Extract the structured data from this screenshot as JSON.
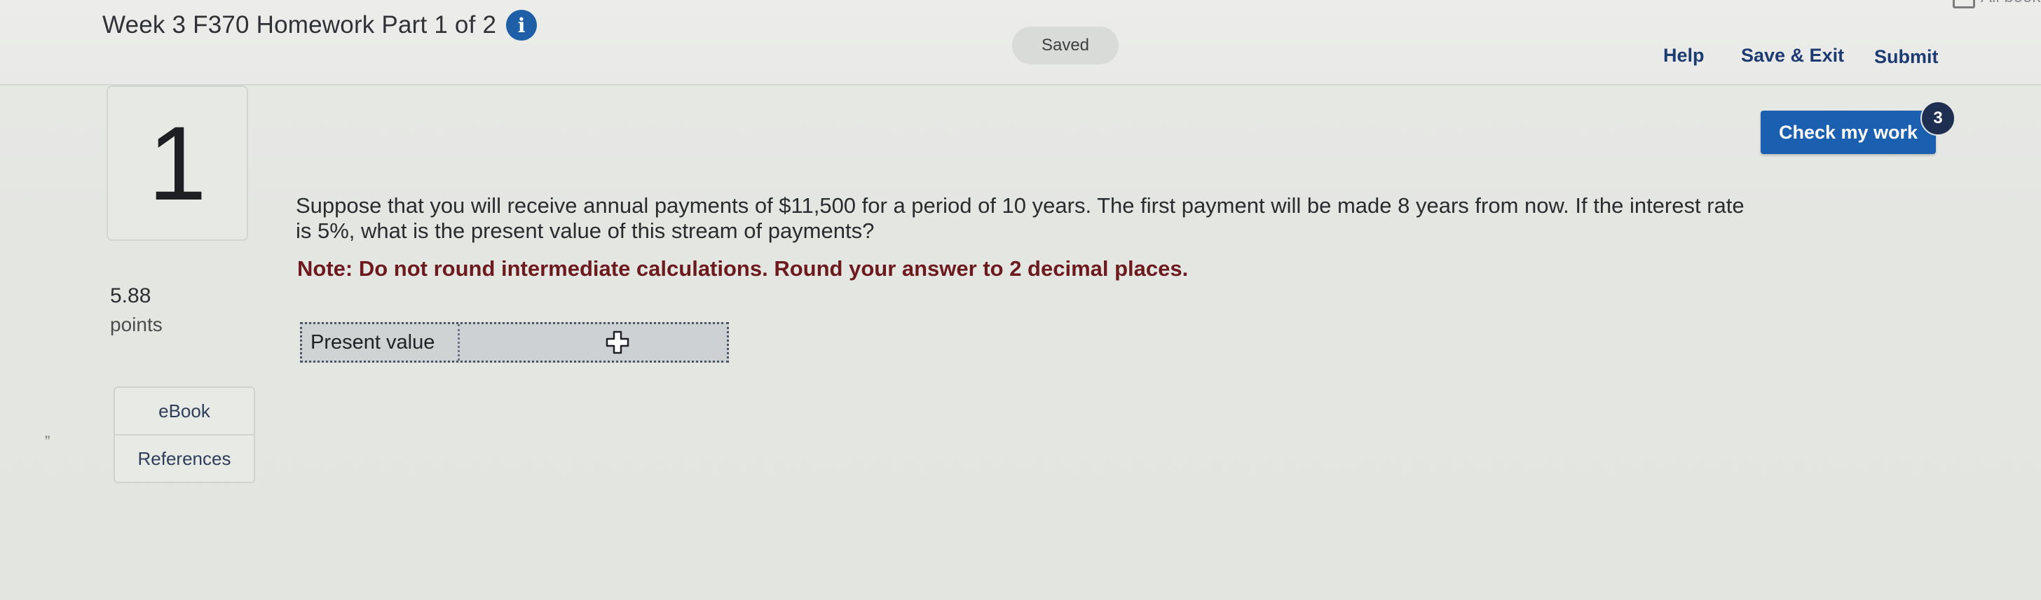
{
  "header": {
    "title": "Week 3 F370 Homework Part 1 of 2",
    "info_icon": "i",
    "saved_status": "Saved",
    "links": {
      "help": "Help",
      "save_exit": "Save & Exit",
      "submit": "Submit"
    },
    "corner_text": "All books"
  },
  "check_work": {
    "label": "Check my work",
    "badge_count": "3"
  },
  "question": {
    "number": "1",
    "points_value": "5.88",
    "points_label": "points",
    "text": "Suppose that you will receive annual payments of $11,500 for a period of 10 years. The first payment will be made 8 years from now. If the interest rate is 5%, what is the present value of this stream of payments?",
    "note": "Note: Do not round intermediate calculations. Round your answer to 2 decimal places."
  },
  "side_buttons": {
    "ebook": "eBook",
    "references": "References"
  },
  "answer_table": {
    "label": "Present value",
    "value": ""
  },
  "stray_mark": "”",
  "colors": {
    "accent_blue": "#1b5fb0",
    "link_navy": "#1d3b73",
    "note_red": "#6d1a1f",
    "badge_dark": "#1f2f52"
  }
}
